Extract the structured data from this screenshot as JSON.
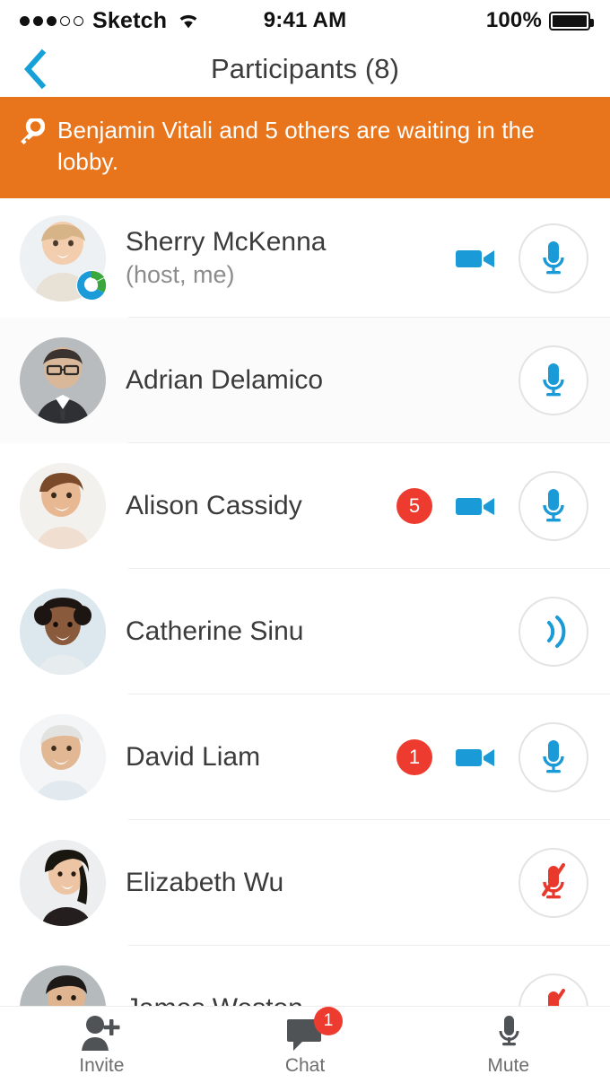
{
  "statusbar": {
    "carrier": "Sketch",
    "signal_dots_filled": 3,
    "signal_dots_total": 5,
    "wifi_icon": "wifi-icon",
    "time": "9:41 AM",
    "battery_percent": "100%",
    "battery_icon": "battery-full-icon"
  },
  "navbar": {
    "back_icon": "chevron-left-icon",
    "title": "Participants (8)",
    "accent_color": "#16a0d8"
  },
  "banner": {
    "icon": "key-icon",
    "text": "Benjamin Vitali and 5 others are waiting in the lobby.",
    "background_color": "#e8751c",
    "text_color": "#ffffff"
  },
  "colors": {
    "accent_blue": "#1a9ad7",
    "badge_red": "#ee3b30",
    "muted_red": "#e8392c",
    "name_gray": "#3b3b3b",
    "sub_gray": "#8c8c8c",
    "separator": "#ececed"
  },
  "participants": [
    {
      "name": "Sherry McKenna",
      "subtitle": "(host, me)",
      "avatar": "avatar-sherry-mckenna",
      "status_badge": "webex-status-badge",
      "count_badge": null,
      "video_icon": "video-camera-icon",
      "audio_icon": "microphone-icon",
      "audio_state": "unmuted",
      "row_tint": false
    },
    {
      "name": "Adrian Delamico",
      "subtitle": null,
      "avatar": "avatar-adrian-delamico",
      "status_badge": null,
      "count_badge": null,
      "video_icon": null,
      "audio_icon": "microphone-icon",
      "audio_state": "unmuted",
      "row_tint": true
    },
    {
      "name": "Alison Cassidy",
      "subtitle": null,
      "avatar": "avatar-alison-cassidy",
      "status_badge": null,
      "count_badge": "5",
      "video_icon": "video-camera-icon",
      "audio_icon": "microphone-icon",
      "audio_state": "unmuted",
      "row_tint": false
    },
    {
      "name": "Catherine Sinu",
      "subtitle": null,
      "avatar": "avatar-catherine-sinu",
      "status_badge": null,
      "count_badge": null,
      "video_icon": null,
      "audio_icon": "audio-waves-icon",
      "audio_state": "phone-audio",
      "row_tint": false
    },
    {
      "name": "David Liam",
      "subtitle": null,
      "avatar": "avatar-david-liam",
      "status_badge": null,
      "count_badge": "1",
      "video_icon": "video-camera-icon",
      "audio_icon": "microphone-icon",
      "audio_state": "unmuted",
      "row_tint": false
    },
    {
      "name": "Elizabeth Wu",
      "subtitle": null,
      "avatar": "avatar-elizabeth-wu",
      "status_badge": null,
      "count_badge": null,
      "video_icon": null,
      "audio_icon": "microphone-muted-icon",
      "audio_state": "muted",
      "row_tint": false
    },
    {
      "name": "James Weston",
      "subtitle": null,
      "avatar": "avatar-james-weston",
      "status_badge": null,
      "count_badge": null,
      "video_icon": null,
      "audio_icon": "microphone-muted-icon",
      "audio_state": "muted",
      "row_tint": false
    }
  ],
  "toolbar": {
    "items": [
      {
        "label": "Invite",
        "icon": "add-person-icon",
        "badge": null
      },
      {
        "label": "Chat",
        "icon": "chat-bubble-icon",
        "badge": "1"
      },
      {
        "label": "Mute",
        "icon": "microphone-icon",
        "badge": null
      }
    ]
  }
}
